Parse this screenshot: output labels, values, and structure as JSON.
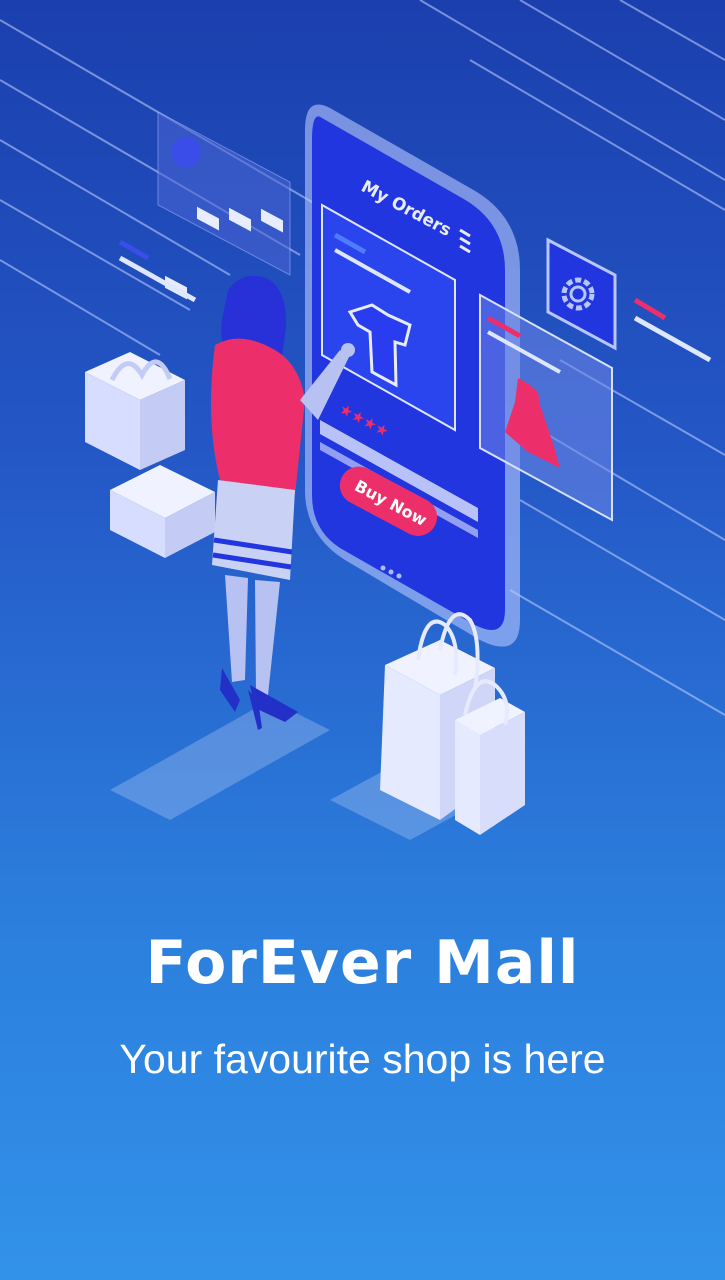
{
  "app": {
    "title": "ForEver Mall",
    "tagline": "Your favourite shop is here"
  },
  "illustration": {
    "screen_title": "My Orders",
    "cta_label": "Buy Now",
    "rating_stars": "★★★★"
  },
  "colors": {
    "background_top": "#1b3fae",
    "background_bottom": "#3292ea",
    "accent_pink": "#ec2f6b",
    "phone_blue": "#2236e0"
  },
  "icons": [
    "gear-icon",
    "menu-icon",
    "tshirt-icon",
    "dress-icon",
    "shopping-bag-icon",
    "gift-box-icon"
  ]
}
